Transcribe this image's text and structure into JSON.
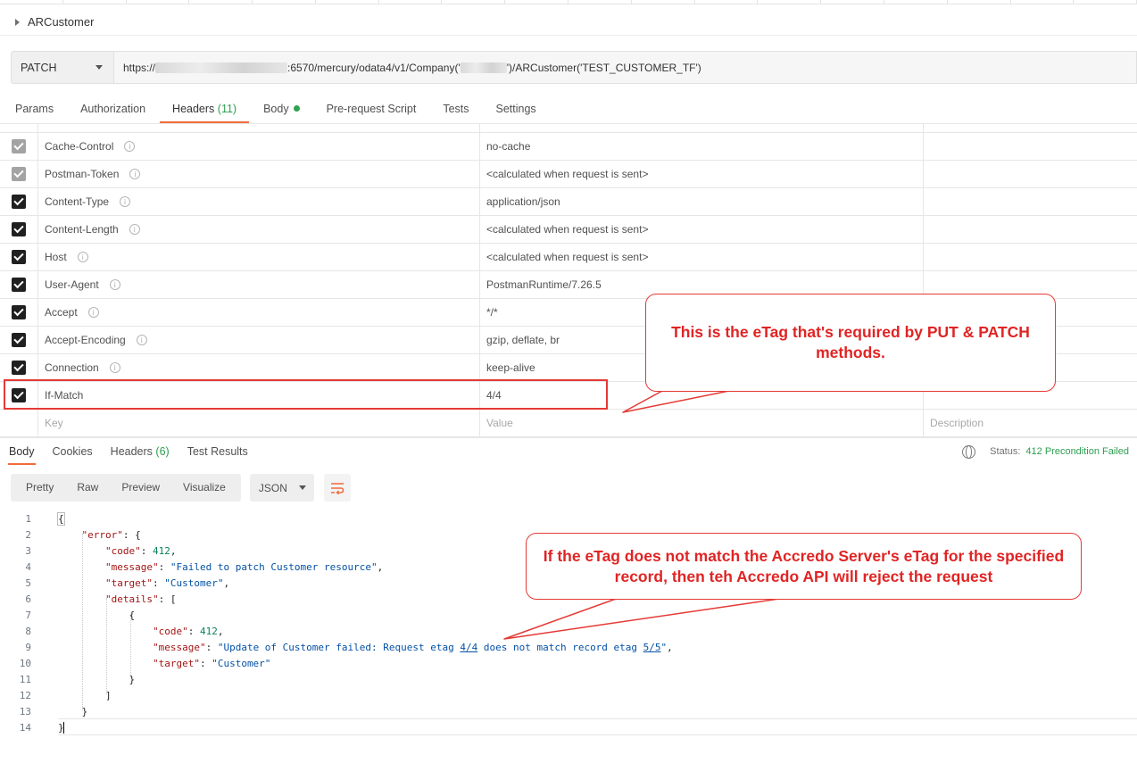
{
  "window": {
    "title": "ARCustomer"
  },
  "request": {
    "method": "PATCH",
    "url_prefix": "https://",
    "url_middle": ":6570/mercury/odata4/v1/Company('",
    "url_suffix": "')/ARCustomer('TEST_CUSTOMER_TF')"
  },
  "request_tabs": {
    "params": "Params",
    "authorization": "Authorization",
    "headers": "Headers",
    "headers_count": "(11)",
    "body": "Body",
    "prerequest": "Pre-request Script",
    "tests": "Tests",
    "settings": "Settings"
  },
  "headers": [
    {
      "key": "Cache-Control",
      "value": "no-cache",
      "checked": "auto"
    },
    {
      "key": "Postman-Token",
      "value": "<calculated when request is sent>",
      "checked": "auto"
    },
    {
      "key": "Content-Type",
      "value": "application/json",
      "checked": "on"
    },
    {
      "key": "Content-Length",
      "value": "<calculated when request is sent>",
      "checked": "on"
    },
    {
      "key": "Host",
      "value": "<calculated when request is sent>",
      "checked": "on"
    },
    {
      "key": "User-Agent",
      "value": "PostmanRuntime/7.26.5",
      "checked": "on"
    },
    {
      "key": "Accept",
      "value": "*/*",
      "checked": "on"
    },
    {
      "key": "Accept-Encoding",
      "value": "gzip, deflate, br",
      "checked": "on"
    },
    {
      "key": "Connection",
      "value": "keep-alive",
      "checked": "on"
    },
    {
      "key": "If-Match",
      "value": "4/4",
      "checked": "on"
    }
  ],
  "new_header_placeholders": {
    "key": "Key",
    "value": "Value",
    "description": "Description"
  },
  "response_tabs": {
    "body": "Body",
    "cookies": "Cookies",
    "headers": "Headers",
    "headers_count": "(6)",
    "test_results": "Test Results"
  },
  "status": {
    "label": "Status:",
    "code": "412 Precondition Failed",
    "color": "#2d9e4f"
  },
  "format": {
    "pretty": "Pretty",
    "raw": "Raw",
    "preview": "Preview",
    "visualize": "Visualize",
    "language": "JSON"
  },
  "code": {
    "line_numbers": [
      "1",
      "2",
      "3",
      "4",
      "5",
      "6",
      "7",
      "8",
      "9",
      "10",
      "11",
      "12",
      "13",
      "14"
    ],
    "brace_open": "{",
    "error_key": "\"error\"",
    "colon_brace": ": {",
    "code_key": "\"code\"",
    "code_val": "412",
    "message_key": "\"message\"",
    "message_val": "\"Failed to patch Customer resource\"",
    "target_key": "\"target\"",
    "target_val": "\"Customer\"",
    "details_key": "\"details\"",
    "colon_bracket": ": [",
    "inner_open": "{",
    "inner_code_val": "412",
    "inner_msg_a": "\"Update of Customer failed: Request etag ",
    "inner_msg_u1": "4/4",
    "inner_msg_b": " does not match record etag ",
    "inner_msg_u2": "5/5",
    "inner_msg_c": "\"",
    "inner_target_val": "\"Customer\"",
    "inner_close": "}",
    "bracket_close": "]",
    "obj_close": "}",
    "brace_close": "}"
  },
  "annotations": {
    "etag_note": "This is the eTag that's required by PUT & PATCH methods.",
    "mismatch_note": "If the eTag does not match the Accredo Server's eTag for the specified record, then teh Accredo API will reject the request",
    "color": "#e53935"
  }
}
